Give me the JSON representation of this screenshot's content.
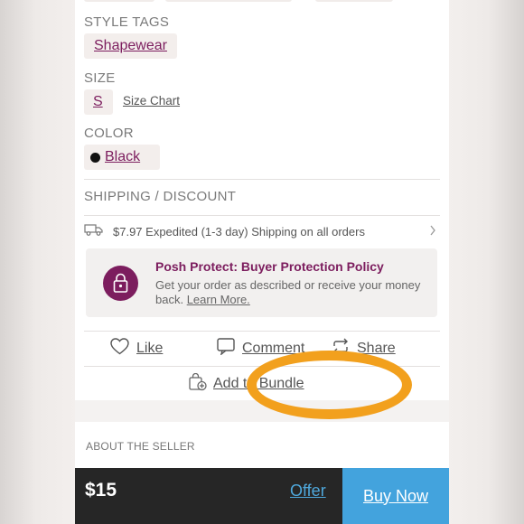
{
  "style_tags": {
    "label": "STYLE TAGS",
    "tag": "Shapewear"
  },
  "size": {
    "label": "SIZE",
    "value": "S",
    "chart_link": "Size Chart"
  },
  "color": {
    "label": "COLOR",
    "value": "Black",
    "swatch": "#111111"
  },
  "shipping": {
    "label": "SHIPPING / DISCOUNT",
    "text": "$7.97 Expedited (1-3 day) Shipping on all orders",
    "icon": "truck-icon"
  },
  "protect": {
    "title": "Posh Protect: Buyer Protection Policy",
    "desc": "Get your order as described or receive your money back.",
    "link": "Learn More.",
    "icon": "lock-bag-icon"
  },
  "actions": {
    "like": "Like",
    "comment": "Comment",
    "share": "Share",
    "bundle": "Add to Bundle"
  },
  "seller": {
    "label": "ABOUT THE SELLER"
  },
  "bottom": {
    "price": "$15",
    "offer": "Offer",
    "buy": "Buy Now"
  },
  "colors": {
    "accent": "#7c1d5e",
    "blue": "#43a3dd",
    "highlight": "#f2a01d",
    "bar": "#262626"
  }
}
